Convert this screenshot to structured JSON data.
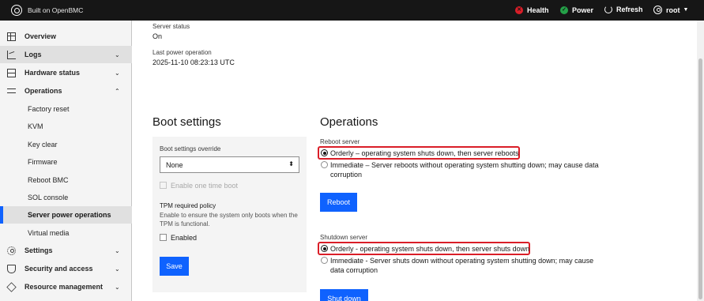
{
  "header": {
    "brand": "Built on OpenBMC",
    "health": "Health",
    "power": "Power",
    "refresh": "Refresh",
    "user": "root",
    "colors": {
      "health": "#da1e28",
      "power": "#24a148",
      "bar": "#161616"
    }
  },
  "sidebar": {
    "items": [
      {
        "label": "Overview",
        "icon": "grid-icon"
      },
      {
        "label": "Logs",
        "icon": "chart-icon"
      },
      {
        "label": "Hardware status",
        "icon": "server-icon"
      },
      {
        "label": "Operations",
        "icon": "sliders-icon"
      },
      {
        "label": "Settings",
        "icon": "gear-icon"
      },
      {
        "label": "Security and access",
        "icon": "shield-icon"
      },
      {
        "label": "Resource management",
        "icon": "stack-icon"
      }
    ],
    "operations_children": [
      "Factory reset",
      "KVM",
      "Key clear",
      "Firmware",
      "Reboot BMC",
      "SOL console",
      "Server power operations",
      "Virtual media"
    ],
    "selected": "Server power operations",
    "accent": "#0f62fe"
  },
  "status": {
    "server_status_label": "Server status",
    "server_status_value": "On",
    "last_power_label": "Last power operation",
    "last_power_value": "2025-11-10 08:23:13 UTC"
  },
  "boot": {
    "title": "Boot settings",
    "override_label": "Boot settings override",
    "override_value": "None",
    "one_time_label": "Enable one time boot",
    "tpm_label": "TPM required policy",
    "tpm_help": "Enable to ensure the system only boots when the TPM is functional.",
    "enabled_label": "Enabled",
    "save_label": "Save"
  },
  "operations": {
    "title": "Operations",
    "reboot_label": "Reboot server",
    "reboot_orderly": "Orderly – operating system shuts down, then server reboots",
    "reboot_immediate": "Immediate – Server reboots without operating system shutting down; may cause data corruption",
    "reboot_button": "Reboot",
    "shutdown_label": "Shutdown server",
    "shutdown_orderly": "Orderly - operating system shuts down, then server shuts down",
    "shutdown_immediate": "Immediate - Server shuts down without operating system shutting down; may cause data corruption",
    "shutdown_button": "Shut down"
  }
}
